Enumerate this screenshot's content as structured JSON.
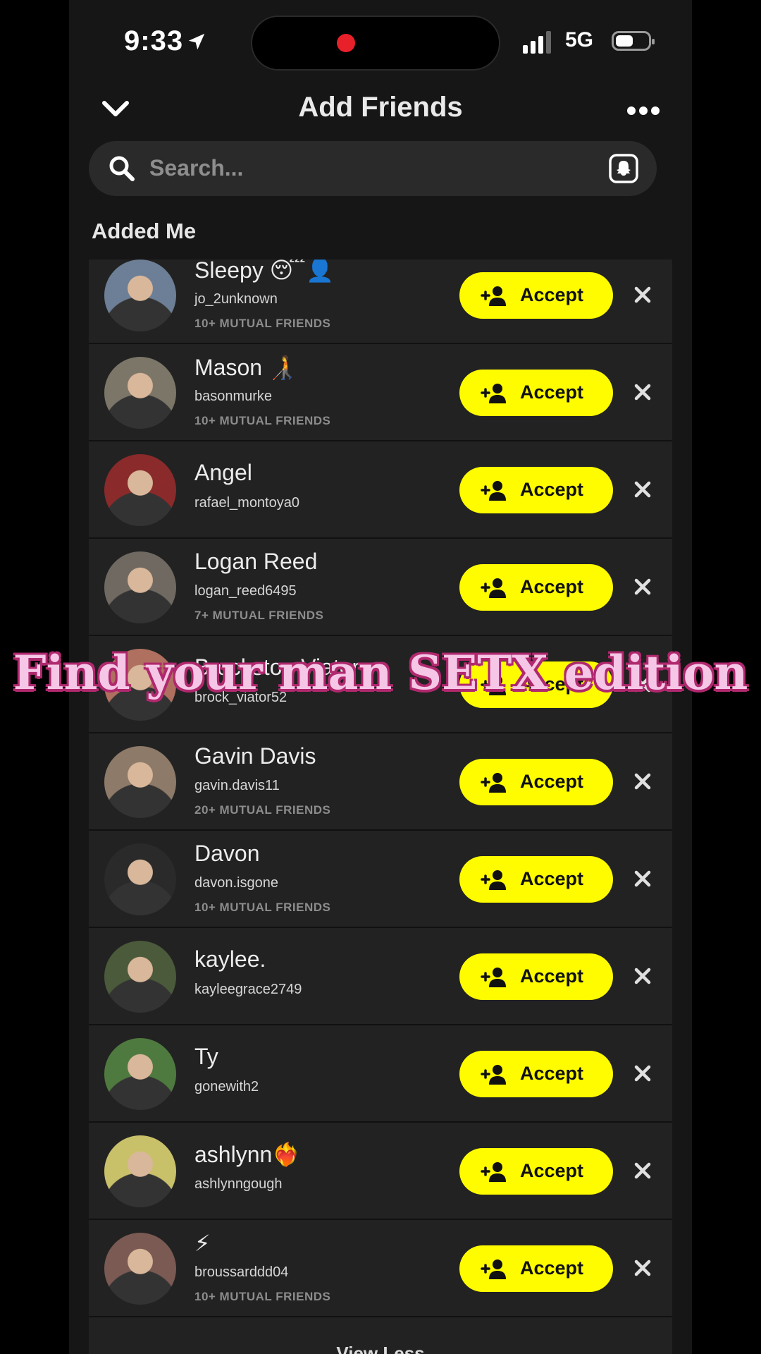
{
  "status_bar": {
    "time": "9:33",
    "network": "5G"
  },
  "header": {
    "title": "Add Friends"
  },
  "search": {
    "placeholder": "Search..."
  },
  "section": {
    "label": "Added Me"
  },
  "accept_label": "Accept",
  "requests": [
    {
      "name": "Sleepy 😴👤",
      "username": "jo_2unknown",
      "mutual": "10+ MUTUAL FRIENDS",
      "avatar_color": "#6d7f96"
    },
    {
      "name": "Mason 🧑‍🦯",
      "username": "basonmurke",
      "mutual": "10+ MUTUAL FRIENDS",
      "avatar_color": "#7c7668"
    },
    {
      "name": "Angel",
      "username": "rafael_montoya0",
      "mutual": "",
      "avatar_color": "#8a2a2a"
    },
    {
      "name": "Logan Reed",
      "username": "logan_reed6495",
      "mutual": "7+ MUTUAL FRIENDS",
      "avatar_color": "#6f6962"
    },
    {
      "name": "Brockston Viator",
      "username": "brock_viator52",
      "mutual": "",
      "avatar_color": "#b07060"
    },
    {
      "name": "Gavin Davis",
      "username": "gavin.davis11",
      "mutual": "20+ MUTUAL FRIENDS",
      "avatar_color": "#8d7a68"
    },
    {
      "name": "Davon",
      "username": "davon.isgone",
      "mutual": "10+ MUTUAL FRIENDS",
      "avatar_color": "#2a2a2a"
    },
    {
      "name": "kaylee.",
      "username": "kayleegrace2749",
      "mutual": "",
      "avatar_color": "#4a5a3a"
    },
    {
      "name": "Ty",
      "username": "gonewith2",
      "mutual": "",
      "avatar_color": "#4f7a3f"
    },
    {
      "name": "ashlynn❤️‍🔥",
      "username": "ashlynngough",
      "mutual": "",
      "avatar_color": "#c9c06a"
    },
    {
      "name": "⚡",
      "username": "broussarddd04",
      "mutual": "10+ MUTUAL FRIENDS",
      "avatar_color": "#7a5a52"
    }
  ],
  "footer": {
    "view_less": "View Less"
  },
  "overlay": {
    "caption": "Find your man SETX edition"
  },
  "colors": {
    "accent": "#fffc00",
    "background": "#161616",
    "row": "#222222",
    "caption": "#f6c6e6",
    "caption_outline": "#b0286e"
  }
}
